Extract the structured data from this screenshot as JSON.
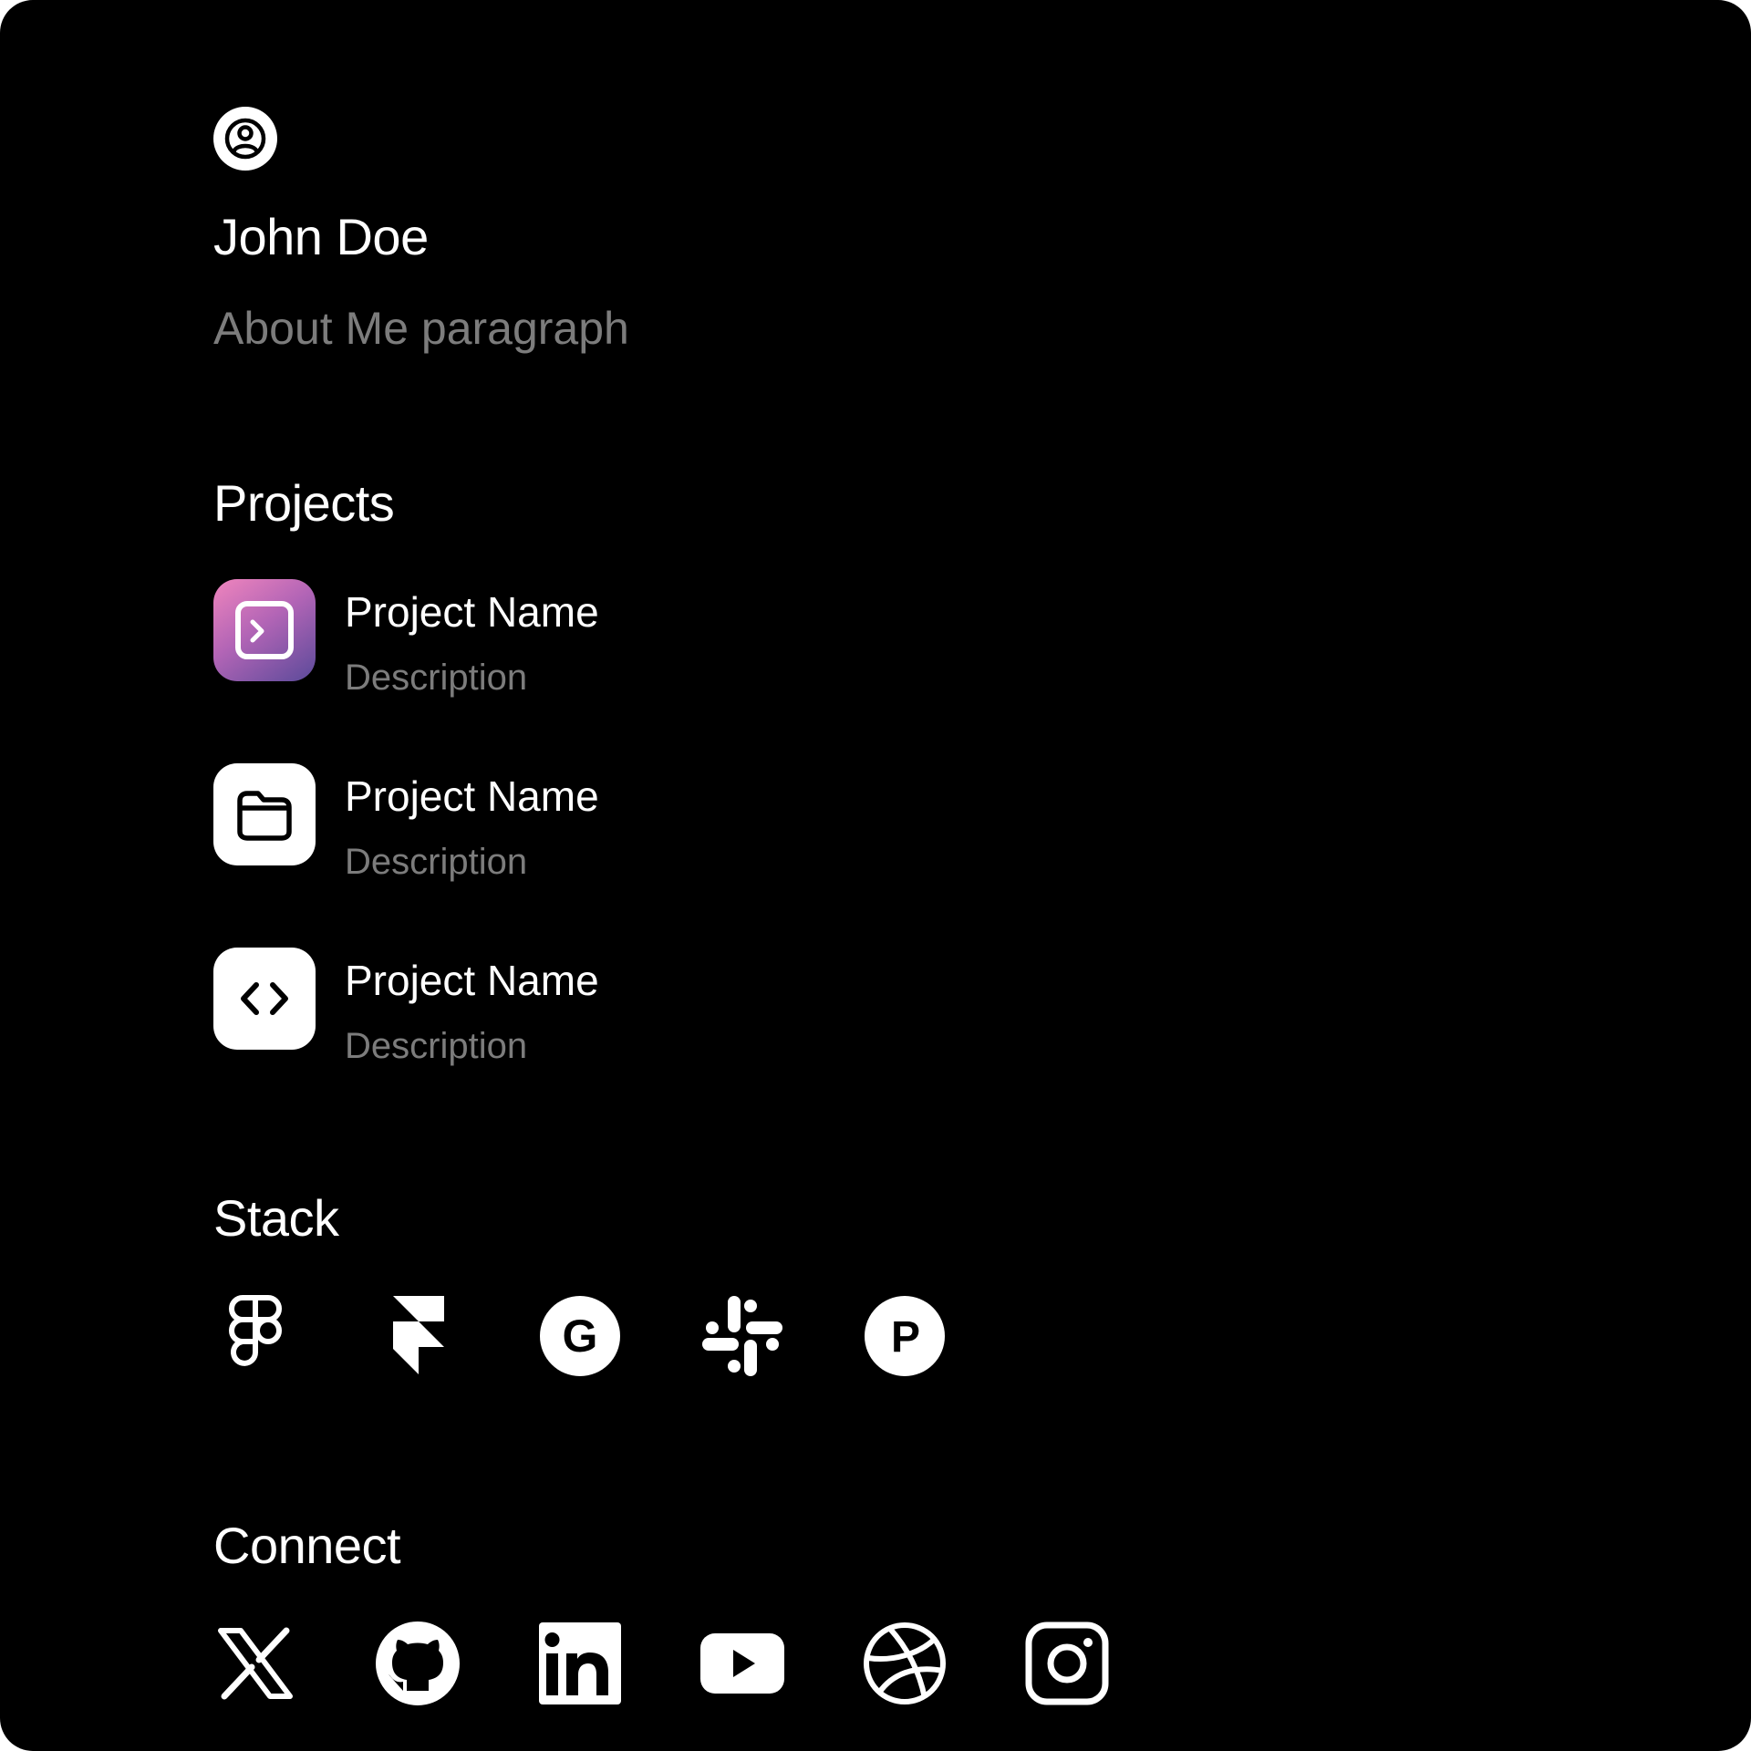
{
  "profile": {
    "name": "John Doe",
    "about": "About Me paragraph",
    "avatar_icon": "user-circle-icon"
  },
  "projects": {
    "title": "Projects",
    "items": [
      {
        "name": "Project Name",
        "description": "Description",
        "icon": "terminal-icon"
      },
      {
        "name": "Project Name",
        "description": "Description",
        "icon": "folder-icon"
      },
      {
        "name": "Project Name",
        "description": "Description",
        "icon": "code-icon"
      }
    ]
  },
  "stack": {
    "title": "Stack",
    "items": [
      {
        "icon": "figma-icon"
      },
      {
        "icon": "framer-icon"
      },
      {
        "icon": "grammarly-icon"
      },
      {
        "icon": "slack-icon"
      },
      {
        "icon": "producthunt-icon"
      }
    ]
  },
  "connect": {
    "title": "Connect",
    "items": [
      {
        "icon": "x-icon"
      },
      {
        "icon": "github-icon"
      },
      {
        "icon": "linkedin-icon"
      },
      {
        "icon": "youtube-icon"
      },
      {
        "icon": "dribbble-icon"
      },
      {
        "icon": "instagram-icon"
      }
    ]
  },
  "colors": {
    "background": "#000000",
    "text": "#ffffff",
    "muted": "#7c7c7c",
    "gradient_start": "#f085bd",
    "gradient_end": "#5b4a9a"
  }
}
